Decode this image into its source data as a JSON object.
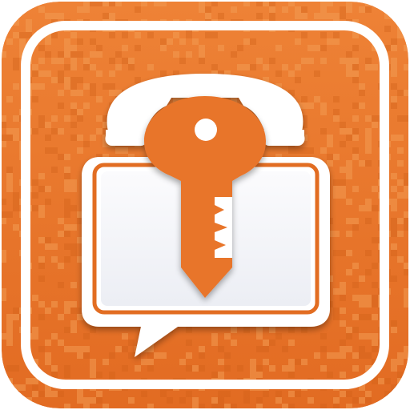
{
  "app_icon": {
    "name": "secure-phone-messenger-app-icon",
    "icons": [
      "phone-handset-icon",
      "key-icon",
      "chat-bubble-icon"
    ],
    "colors": {
      "background_orange": "#e9782c",
      "background_orange_dark": "#d9661d",
      "pixel_light": "#f39a52",
      "pixel_dark": "#cf5f18",
      "frame_white": "#ffffff",
      "bubble_fill": "#f5f6fa",
      "bubble_border": "#ffffff",
      "bubble_inner_stroke": "#e26d22",
      "key_orange": "#e8742a",
      "shadow": "#b24e10"
    }
  }
}
